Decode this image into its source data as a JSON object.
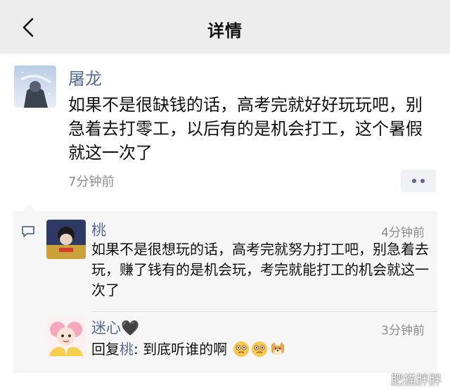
{
  "header": {
    "title": "详情",
    "back_icon": "chevron-left-icon"
  },
  "post": {
    "author": "屠龙",
    "content": "如果不是很缺钱的话，高考完就好好玩玩吧，别急着去打零工，以后有的是机会打工，这个暑假就这一次了",
    "time": "7分钟前",
    "more_icon": "more-dots-icon"
  },
  "comments": [
    {
      "author": "桃",
      "time": "4分钟前",
      "text": "如果不是很想玩的话，高考完就努力打工吧，别急着去玩，赚了钱有的是机会玩，考完就能打工的机会就这一次了"
    },
    {
      "author": "迷心🖤",
      "time": "3分钟前",
      "reply_prefix": "回复",
      "reply_to": "桃",
      "reply_text": ": 到底听谁的啊",
      "emojis": [
        "thinking-face-emoji",
        "thinking-face-emoji",
        "doge-emoji"
      ]
    }
  ],
  "watermark": "肥猫胖胖",
  "colors": {
    "link": "#576b95",
    "header_bg": "#ededed",
    "comments_bg": "#f6f6f6",
    "meta": "#8c8c8c"
  }
}
